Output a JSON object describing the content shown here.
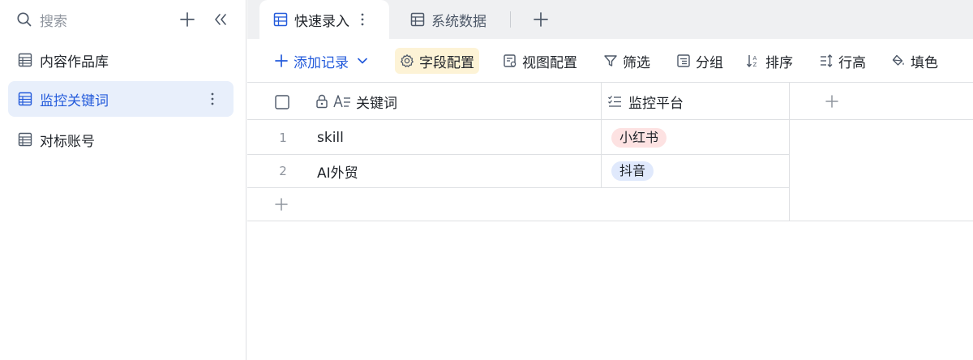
{
  "sidebar": {
    "search_label": "搜索",
    "items": [
      {
        "label": "内容作品库"
      },
      {
        "label": "监控关键词"
      },
      {
        "label": "对标账号"
      }
    ]
  },
  "tabs": [
    {
      "label": "快速录入"
    },
    {
      "label": "系统数据"
    }
  ],
  "toolbar": {
    "add_record": "添加记录",
    "field_config": "字段配置",
    "view_config": "视图配置",
    "filter": "筛选",
    "group": "分组",
    "sort": "排序",
    "row_height": "行高",
    "fill": "填色"
  },
  "table": {
    "columns": [
      {
        "label": "关键词"
      },
      {
        "label": "监控平台"
      }
    ],
    "rows": [
      {
        "num": "1",
        "keyword": "skill",
        "platform": "小红书",
        "platform_color": "#fde2e2"
      },
      {
        "num": "2",
        "keyword": "AI外贸",
        "platform": "抖音",
        "platform_color": "#e0e9fc"
      }
    ]
  },
  "colors": {
    "accent": "#245bdb",
    "active_bg": "#e8effb",
    "field_config_bg": "#fdf3d6"
  },
  "icons": [
    "search-icon",
    "plus-icon",
    "collapse-icon",
    "table-icon",
    "more-icon",
    "chevron-down-icon",
    "gear-icon",
    "view-config-icon",
    "filter-icon",
    "group-icon",
    "sort-icon",
    "row-height-icon",
    "fill-icon",
    "lock-icon",
    "text-field-icon",
    "multi-select-icon"
  ]
}
